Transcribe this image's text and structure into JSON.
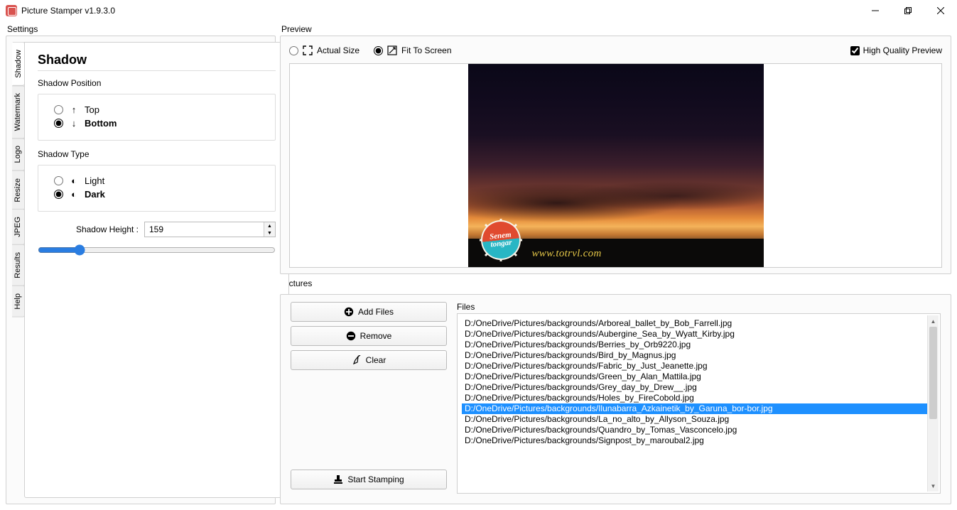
{
  "app": {
    "title": "Picture Stamper v1.9.3.0"
  },
  "layout": {
    "settings_label": "Settings",
    "preview_label": "Preview",
    "pictures_label": "Pictures"
  },
  "tabs": [
    "Shadow",
    "Watermark",
    "Logo",
    "Resize",
    "JPEG",
    "Results",
    "Help"
  ],
  "active_tab": "Shadow",
  "shadow": {
    "heading": "Shadow",
    "position_label": "Shadow Position",
    "pos_top": "Top",
    "pos_bottom": "Bottom",
    "pos_selected": "Bottom",
    "type_label": "Shadow Type",
    "type_light": "Light",
    "type_dark": "Dark",
    "type_selected": "Dark",
    "height_label": "Shadow Height :",
    "height_value": "159",
    "slider_value": 159,
    "slider_min": 0,
    "slider_max": 1000
  },
  "preview": {
    "actual_size": "Actual Size",
    "fit_to_screen": "Fit To Screen",
    "mode_selected": "Fit To Screen",
    "high_quality": "High Quality Preview",
    "high_quality_checked": true,
    "watermark_url": "www.totrvl.com",
    "logo_line1": "Senem",
    "logo_line2": "tongar"
  },
  "pictures": {
    "add_files": "Add Files",
    "remove": "Remove",
    "clear": "Clear",
    "start": "Start Stamping",
    "files_label": "Files",
    "selected_index": 8,
    "files": [
      "D:/OneDrive/Pictures/backgrounds/Arboreal_ballet_by_Bob_Farrell.jpg",
      "D:/OneDrive/Pictures/backgrounds/Aubergine_Sea_by_Wyatt_Kirby.jpg",
      "D:/OneDrive/Pictures/backgrounds/Berries_by_Orb9220.jpg",
      "D:/OneDrive/Pictures/backgrounds/Bird_by_Magnus.jpg",
      "D:/OneDrive/Pictures/backgrounds/Fabric_by_Just_Jeanette.jpg",
      "D:/OneDrive/Pictures/backgrounds/Green_by_Alan_Mattila.jpg",
      "D:/OneDrive/Pictures/backgrounds/Grey_day_by_Drew__.jpg",
      "D:/OneDrive/Pictures/backgrounds/Holes_by_FireCobold.jpg",
      "D:/OneDrive/Pictures/backgrounds/Ilunabarra_Azkainetik_by_Garuna_bor-bor.jpg",
      "D:/OneDrive/Pictures/backgrounds/La_no_alto_by_Allyson_Souza.jpg",
      "D:/OneDrive/Pictures/backgrounds/Quandro_by_Tomas_Vasconcelo.jpg",
      "D:/OneDrive/Pictures/backgrounds/Signpost_by_maroubal2.jpg"
    ]
  }
}
